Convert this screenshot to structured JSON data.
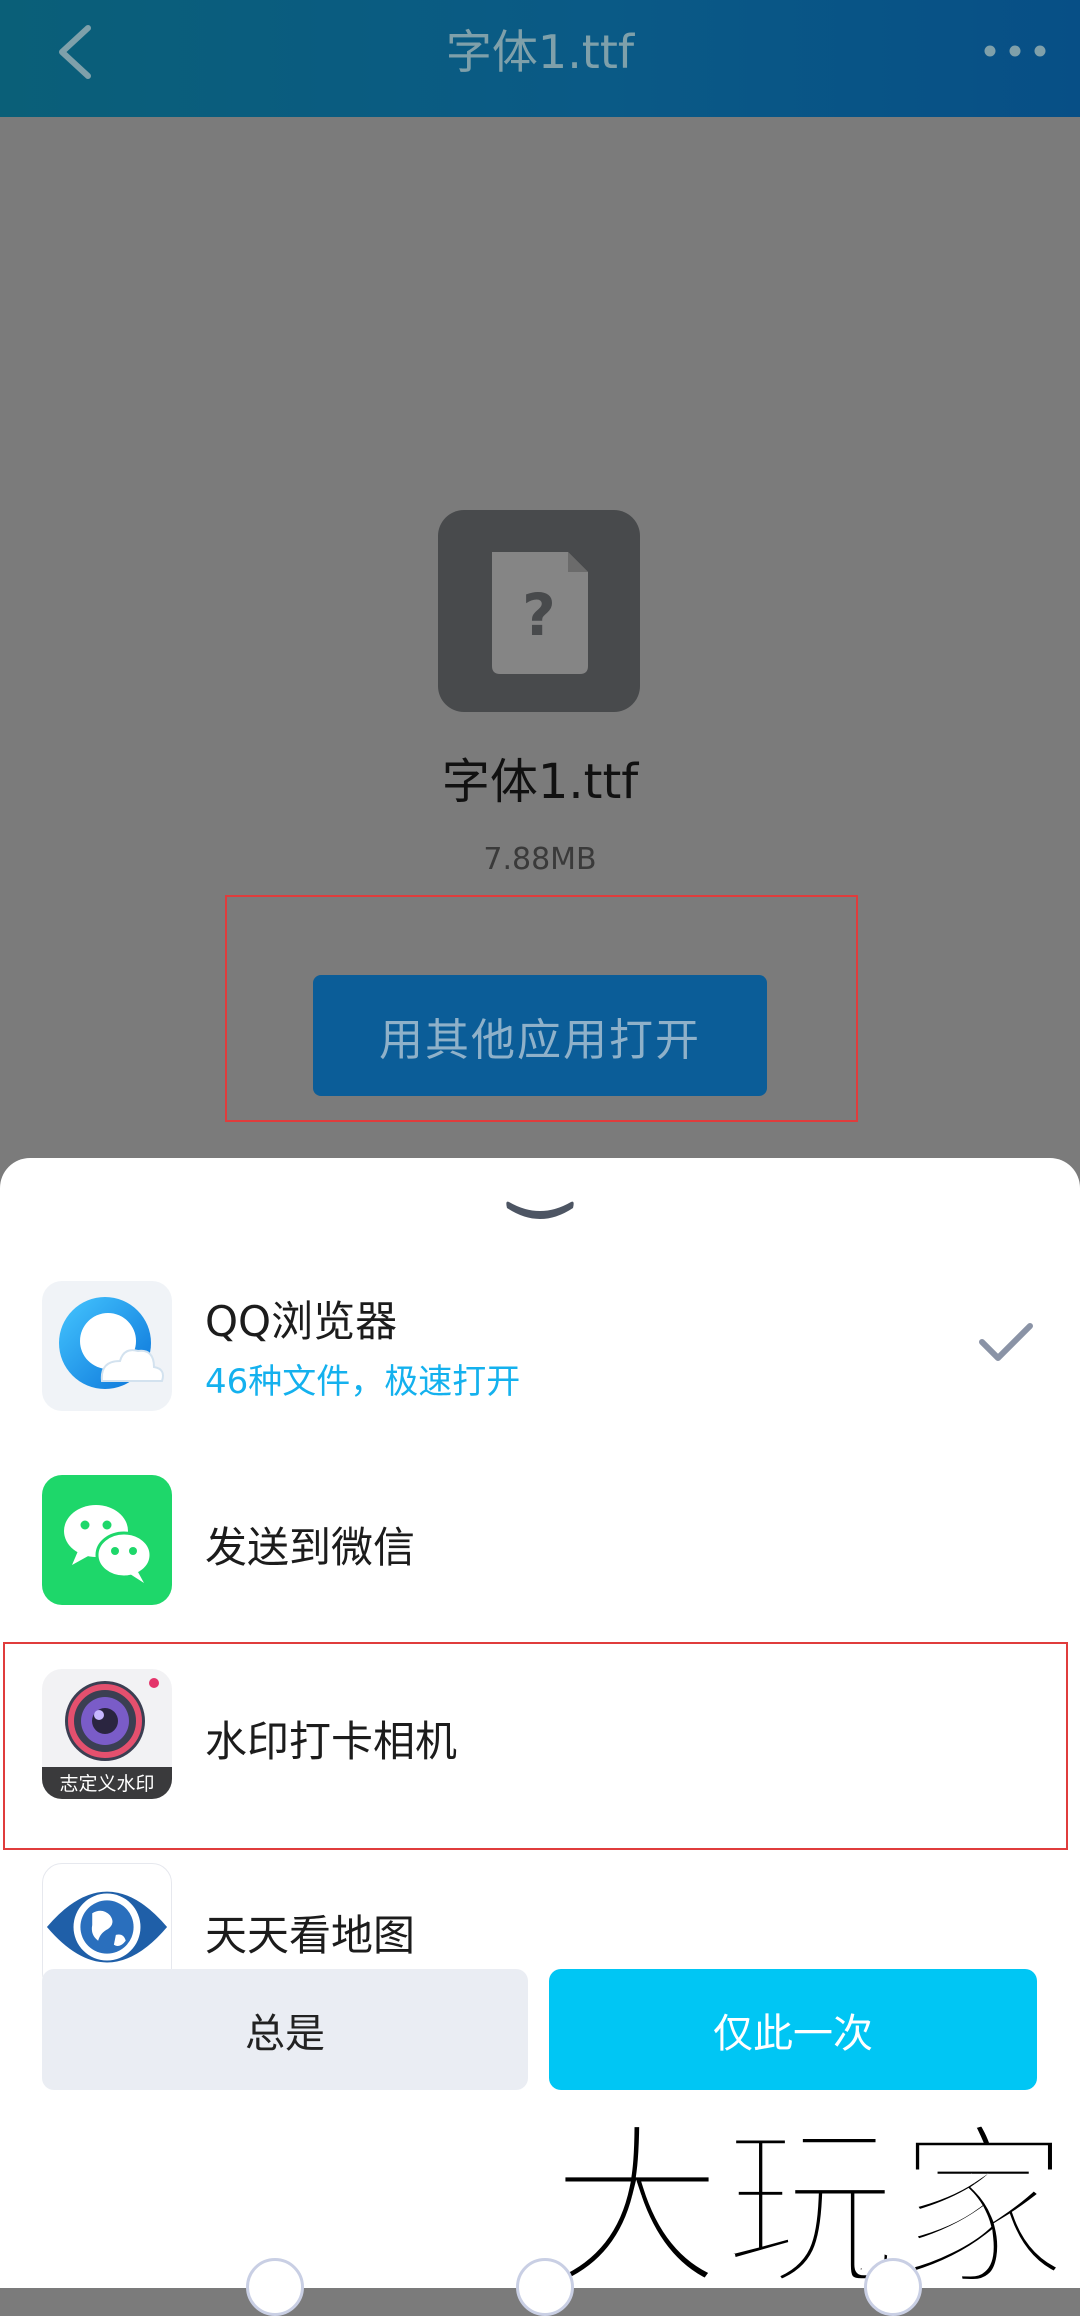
{
  "header": {
    "title": "字体1.ttf",
    "back_icon": "chevron-left-icon",
    "more_icon": "more-horizontal-icon"
  },
  "file": {
    "name": "字体1.ttf",
    "size": "7.88MB",
    "icon": "unknown-file-icon",
    "open_button_label": "用其他应用打开"
  },
  "sheet": {
    "apps": [
      {
        "name": "QQ浏览器",
        "subtitle": "46种文件，极速打开",
        "icon": "qq-browser-icon",
        "selected": true
      },
      {
        "name": "发送到微信",
        "icon": "wechat-icon"
      },
      {
        "name": "水印打卡相机",
        "icon": "watermark-camera-icon",
        "icon_label": "志定义水印"
      },
      {
        "name": "天天看地图",
        "icon": "earth-map-icon"
      }
    ],
    "always_label": "总是",
    "once_label": "仅此一次"
  },
  "watermark": {
    "text": "大玩家"
  },
  "colors": {
    "header": "#0a5a86",
    "open_button": "#0b5d98",
    "accent": "#00c6f4",
    "highlight": "#e03c3c",
    "subtitle": "#14b1ee"
  }
}
